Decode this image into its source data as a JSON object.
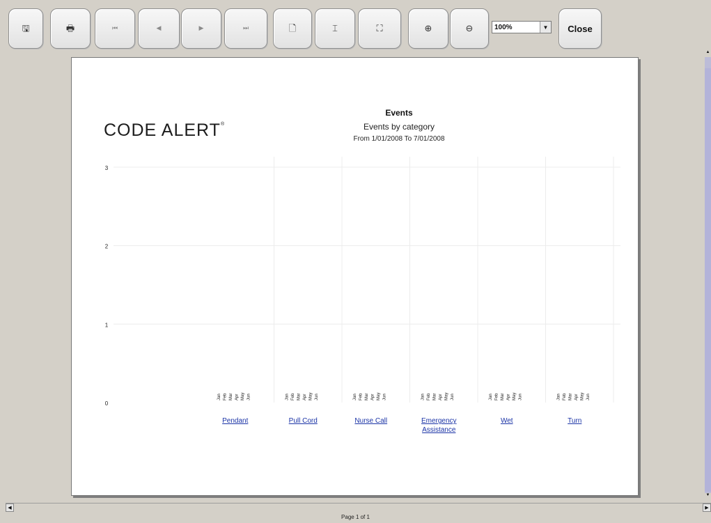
{
  "toolbar": {
    "buttons": [
      {
        "name": "save-button",
        "icon": "save-icon",
        "glyph": "🖫"
      },
      {
        "name": "print-button",
        "icon": "print-icon",
        "glyph": "🖶"
      },
      {
        "name": "first-page-button",
        "icon": "first-page-icon",
        "glyph": "⏮"
      },
      {
        "name": "prev-page-button",
        "icon": "prev-page-icon",
        "glyph": "◀"
      },
      {
        "name": "next-page-button",
        "icon": "next-page-icon",
        "glyph": "▶"
      },
      {
        "name": "last-page-button",
        "icon": "last-page-icon",
        "glyph": "⏭"
      },
      {
        "name": "page-view-button",
        "icon": "page-icon",
        "glyph": "🗋"
      },
      {
        "name": "fit-width-button",
        "icon": "fit-width-icon",
        "glyph": "⌶"
      },
      {
        "name": "fit-page-button",
        "icon": "fit-page-icon",
        "glyph": "⛶"
      },
      {
        "name": "zoom-in-button",
        "icon": "zoom-in-icon",
        "glyph": "⊕"
      },
      {
        "name": "zoom-out-button",
        "icon": "zoom-out-icon",
        "glyph": "⊖"
      }
    ],
    "zoom_value": "100%",
    "close_label": "Close"
  },
  "report": {
    "logo_text": "CODE ALERT",
    "logo_mark": "®",
    "title": "Events",
    "subtitle": "Events by category",
    "date_range": "From 1/01/2008 To 7/01/2008"
  },
  "chart_data": {
    "type": "bar",
    "categories": [
      "Pendant",
      "Pull Cord",
      "Nurse Call",
      "Emergency Assistance",
      "Wet",
      "Turn"
    ],
    "sub_categories": [
      "Jan",
      "Feb",
      "Mar",
      "Apr",
      "May",
      "Jun"
    ],
    "series": [
      {
        "name": "Pendant",
        "values": [
          0,
          0,
          0,
          0,
          0,
          0
        ]
      },
      {
        "name": "Pull Cord",
        "values": [
          0,
          0,
          0,
          0,
          0,
          0
        ]
      },
      {
        "name": "Nurse Call",
        "values": [
          0,
          0,
          0,
          0,
          0,
          0
        ]
      },
      {
        "name": "Emergency Assistance",
        "values": [
          0,
          0,
          0,
          0,
          0,
          0
        ]
      },
      {
        "name": "Wet",
        "values": [
          0,
          0,
          0,
          0,
          0,
          0
        ]
      },
      {
        "name": "Turn",
        "values": [
          0,
          0,
          0,
          0,
          0,
          0
        ]
      }
    ],
    "yticks": [
      0,
      1,
      2,
      3
    ],
    "ylim": [
      0,
      3
    ],
    "grid": true,
    "category_label_color": "#1a33a6"
  },
  "status": {
    "page_label": "Page 1 of 1"
  }
}
